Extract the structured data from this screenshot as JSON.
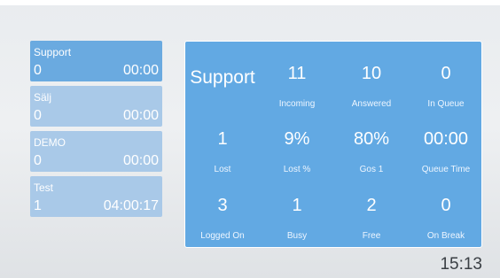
{
  "queues": [
    {
      "name": "Support",
      "count": "0",
      "time": "00:00",
      "active": true
    },
    {
      "name": "Sälj",
      "count": "0",
      "time": "00:00",
      "active": false
    },
    {
      "name": "DEMO",
      "count": "0",
      "time": "00:00",
      "active": false
    },
    {
      "name": "Test",
      "count": "1",
      "time": "04:00:17",
      "active": false
    }
  ],
  "detail": {
    "title": "Support",
    "stats": [
      {
        "value": "11",
        "label": "Incoming"
      },
      {
        "value": "10",
        "label": "Answered"
      },
      {
        "value": "0",
        "label": "In Queue"
      },
      {
        "value": "1",
        "label": "Lost"
      },
      {
        "value": "9%",
        "label": "Lost %"
      },
      {
        "value": "80%",
        "label": "Gos 1"
      },
      {
        "value": "00:00",
        "label": "Queue Time"
      },
      {
        "value": "3",
        "label": "Logged On"
      },
      {
        "value": "1",
        "label": "Busy"
      },
      {
        "value": "2",
        "label": "Free"
      },
      {
        "value": "0",
        "label": "On Break"
      }
    ]
  },
  "clock": "15:13",
  "colors": {
    "panel": "#62a9e3",
    "active_queue": "#6aaae0",
    "inactive_queue": "#a9c9e8"
  }
}
